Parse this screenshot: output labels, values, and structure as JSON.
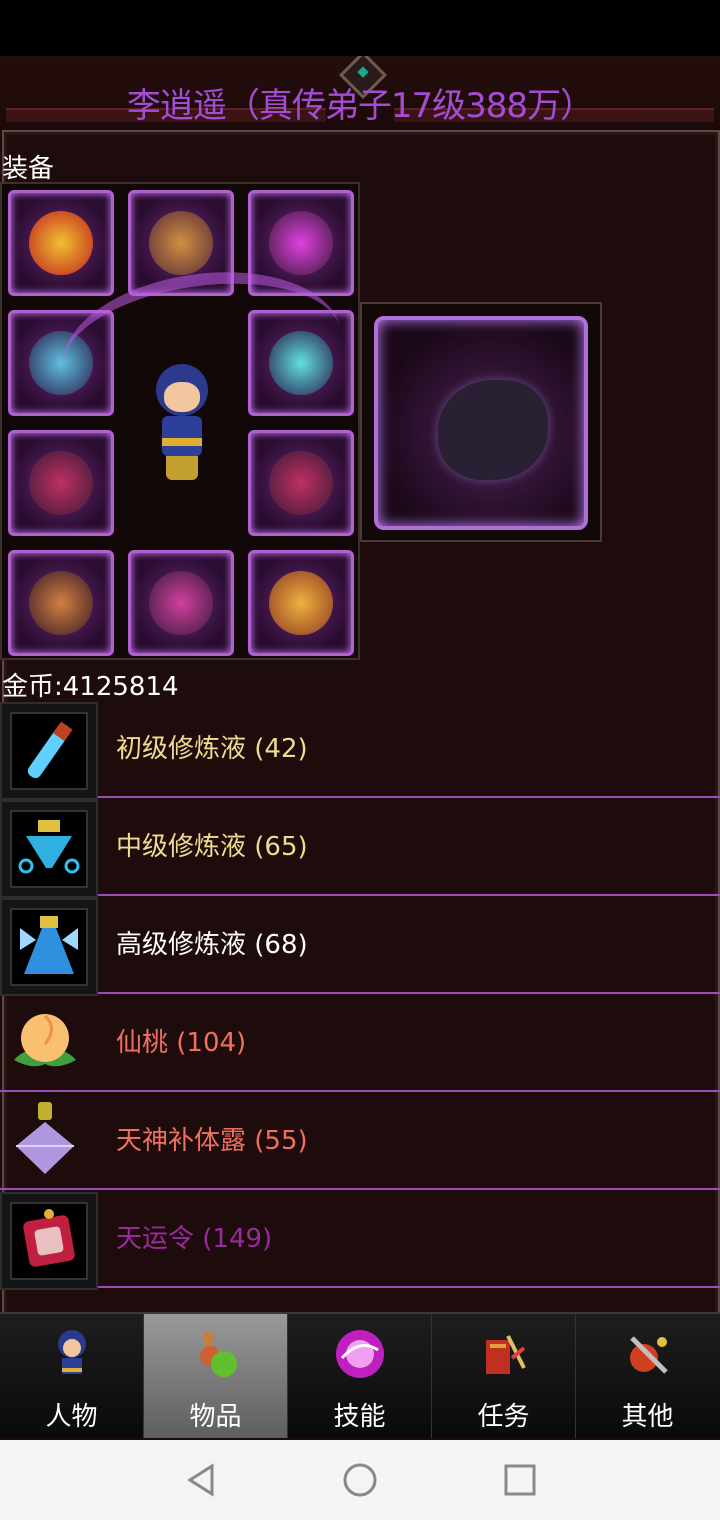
{
  "title": "李逍遥（真传弟子17级388万）",
  "section_label": "装备",
  "gold_label": "金币:4125814",
  "items": [
    {
      "name": "初级修炼液 (42)",
      "icon": "vial-icon"
    },
    {
      "name": "中级修炼液 (65)",
      "icon": "flask-icon"
    },
    {
      "name": "高级修炼液 (68)",
      "icon": "bottle-icon"
    },
    {
      "name": "仙桃 (104)",
      "icon": "peach-icon"
    },
    {
      "name": "天神补体露 (55)",
      "icon": "crystal-potion-icon"
    },
    {
      "name": "天运令 (149)",
      "icon": "token-icon"
    }
  ],
  "tabs": [
    {
      "label": "人物",
      "icon": "character-icon",
      "active": false
    },
    {
      "label": "物品",
      "icon": "potion-icon",
      "active": true
    },
    {
      "label": "技能",
      "icon": "skill-orb-icon",
      "active": false
    },
    {
      "label": "任务",
      "icon": "quest-icon",
      "active": false
    },
    {
      "label": "其他",
      "icon": "misc-icon",
      "active": false
    }
  ],
  "colors": {
    "title": "#a44cd4",
    "item_tier1": "#eedc90",
    "item_white": "#ffffff",
    "item_red": "#f07060",
    "item_purple": "#9a2aa0",
    "divider": "#9a4cb4"
  }
}
